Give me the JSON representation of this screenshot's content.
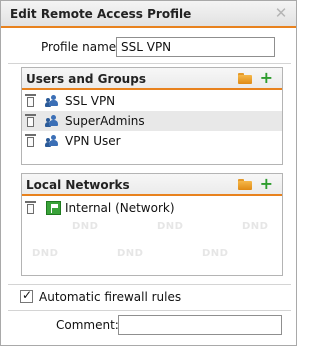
{
  "dialog": {
    "title": "Edit Remote Access Profile",
    "close_glyph": "✕"
  },
  "profile": {
    "label": "Profile name:",
    "value": "SSL VPN"
  },
  "users_groups": {
    "title": "Users and Groups",
    "items": [
      {
        "label": "SSL VPN",
        "icon": "user-group-icon",
        "selected": false
      },
      {
        "label": "SuperAdmins",
        "icon": "user-group-icon",
        "selected": true
      },
      {
        "label": "VPN User",
        "icon": "user-group-icon",
        "selected": false
      }
    ]
  },
  "local_networks": {
    "title": "Local Networks",
    "items": [
      {
        "label": "Internal (Network)",
        "icon": "network-icon",
        "selected": false
      }
    ],
    "watermark": "DND"
  },
  "firewall": {
    "label": "Automatic firewall rules",
    "checked": true,
    "check_glyph": "✓"
  },
  "comment": {
    "label": "Comment:",
    "value": ""
  },
  "colors": {
    "accent": "#e8821e",
    "add": "#2e9d2e",
    "user_icon": "#3b6fb6",
    "network_icon": "#3aa23a"
  }
}
